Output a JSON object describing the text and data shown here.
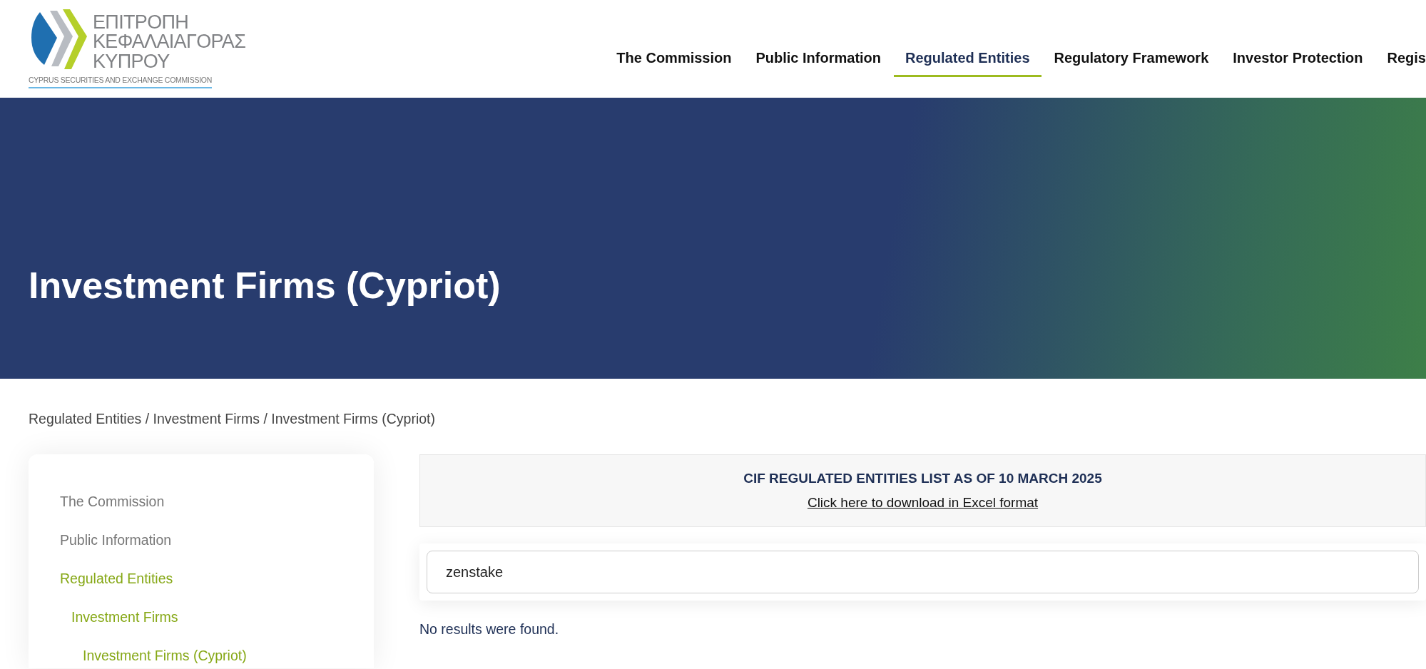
{
  "logo": {
    "lines": [
      "ΕΠΙΤΡΟΠΗ",
      "ΚΕΦΑΛΑΙΑΓΟΡΑΣ",
      "ΚΥΠΡΟΥ"
    ],
    "subtitle": "CYPRUS SECURITIES AND EXCHANGE COMMISSION"
  },
  "nav": [
    {
      "label": "The Commission",
      "selected": false
    },
    {
      "label": "Public Information",
      "selected": false
    },
    {
      "label": "Regulated Entities",
      "selected": true
    },
    {
      "label": "Regulatory Framework",
      "selected": false
    },
    {
      "label": "Investor Protection",
      "selected": false
    },
    {
      "label": "Regis",
      "selected": false
    }
  ],
  "hero": {
    "title": "Investment Firms (Cypriot)"
  },
  "breadcrumb": "Regulated Entities / Investment Firms / Investment Firms (Cypriot)",
  "sidebar": {
    "items": [
      {
        "label": "The Commission",
        "active": false
      },
      {
        "label": "Public Information",
        "active": false
      },
      {
        "label": "Regulated Entities",
        "active": true,
        "children": [
          {
            "label": "Investment Firms",
            "active": true,
            "children": [
              {
                "label": "Investment Firms (Cypriot)",
                "active": true
              }
            ]
          }
        ]
      }
    ]
  },
  "notice": {
    "title": "CIF REGULATED ENTITIES LIST AS OF 10 MARCH 2025",
    "link": "Click here to download in Excel format"
  },
  "search": {
    "value": "zenstake"
  },
  "results_message": "No results were found."
}
